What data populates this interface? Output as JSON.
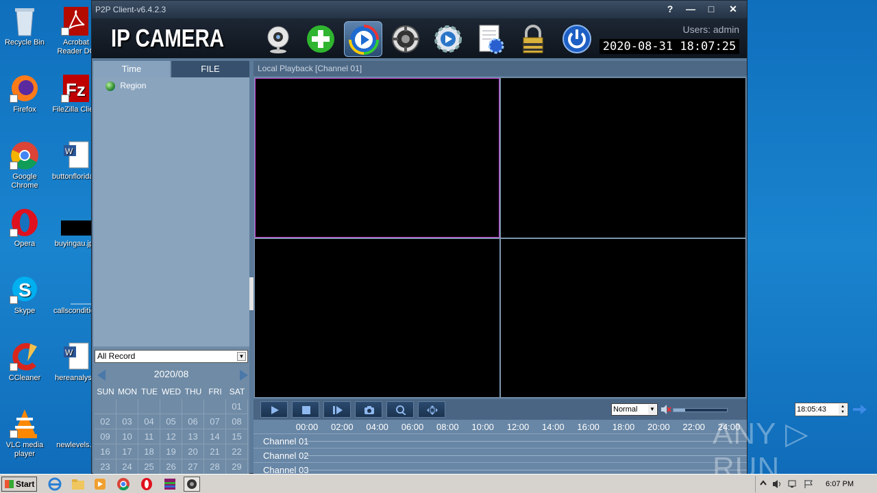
{
  "desktop": {
    "icons": [
      {
        "label": "Recycle Bin",
        "name": "recycle-bin"
      },
      {
        "label": "Acrobat Reader DC",
        "name": "acrobat-reader"
      },
      {
        "label": "Firefox",
        "name": "firefox"
      },
      {
        "label": "FileZilla Client",
        "name": "filezilla"
      },
      {
        "label": "Google Chrome",
        "name": "google-chrome"
      },
      {
        "label": "buttonflorida.rtf",
        "name": "buttonflorida"
      },
      {
        "label": "Opera",
        "name": "opera"
      },
      {
        "label": "buyingau.jpg",
        "name": "buyingau"
      },
      {
        "label": "Skype",
        "name": "skype"
      },
      {
        "label": "callscondition",
        "name": "callscondition"
      },
      {
        "label": "CCleaner",
        "name": "ccleaner"
      },
      {
        "label": "hereanalysis",
        "name": "hereanalysis"
      },
      {
        "label": "VLC media player",
        "name": "vlc"
      },
      {
        "label": "newlevels.p",
        "name": "newlevels"
      }
    ]
  },
  "window": {
    "title": "P2P Client-v6.4.2.3",
    "help_label": "?",
    "min_label": "—",
    "max_label": "□",
    "close_label": "✕"
  },
  "toolbar": {
    "logo": "IP CAMERA",
    "users": "Users: admin",
    "clock": "2020-08-31  18:07:25",
    "tools": [
      {
        "name": "camera-tool",
        "icon": "webcam-icon"
      },
      {
        "name": "add-device-tool",
        "icon": "plus-icon"
      },
      {
        "name": "playback-tool",
        "icon": "play-icon",
        "active": true
      },
      {
        "name": "ptz-tool",
        "icon": "steering-icon"
      },
      {
        "name": "settings-tool",
        "icon": "gear-icon"
      },
      {
        "name": "config-tool",
        "icon": "document-gear-icon"
      },
      {
        "name": "lock-tool",
        "icon": "lock-icon"
      },
      {
        "name": "power-tool",
        "icon": "power-icon"
      }
    ]
  },
  "left_panel": {
    "tabs": [
      "Time",
      "FILE"
    ],
    "tree_root": "Region",
    "record_filter": "All Record",
    "calendar": {
      "month": "2020/08",
      "weekdays": [
        "SUN",
        "MON",
        "TUE",
        "WED",
        "THU",
        "FRI",
        "SAT"
      ],
      "days": [
        "",
        "",
        "",
        "",
        "",
        "",
        "01",
        "02",
        "03",
        "04",
        "05",
        "06",
        "07",
        "08",
        "09",
        "10",
        "11",
        "12",
        "13",
        "14",
        "15",
        "16",
        "17",
        "18",
        "19",
        "20",
        "21",
        "22",
        "23",
        "24",
        "25",
        "26",
        "27",
        "28",
        "29"
      ]
    }
  },
  "playback": {
    "title": "Local Playback [Channel 01]",
    "speed": "Normal",
    "time": "18:05:43",
    "volume": 0.22,
    "hours": [
      "00:00",
      "02:00",
      "04:00",
      "06:00",
      "08:00",
      "10:00",
      "12:00",
      "14:00",
      "16:00",
      "18:00",
      "20:00",
      "22:00",
      "24:00"
    ],
    "channels": [
      "Channel 01",
      "Channel 02",
      "Channel 03"
    ]
  },
  "taskbar": {
    "start": "Start",
    "time": "6:07 PM"
  },
  "watermark": "ANY ▷ RUN",
  "colors": {
    "selected_cell": "#c33ad0",
    "accent": "#4a78a8"
  }
}
